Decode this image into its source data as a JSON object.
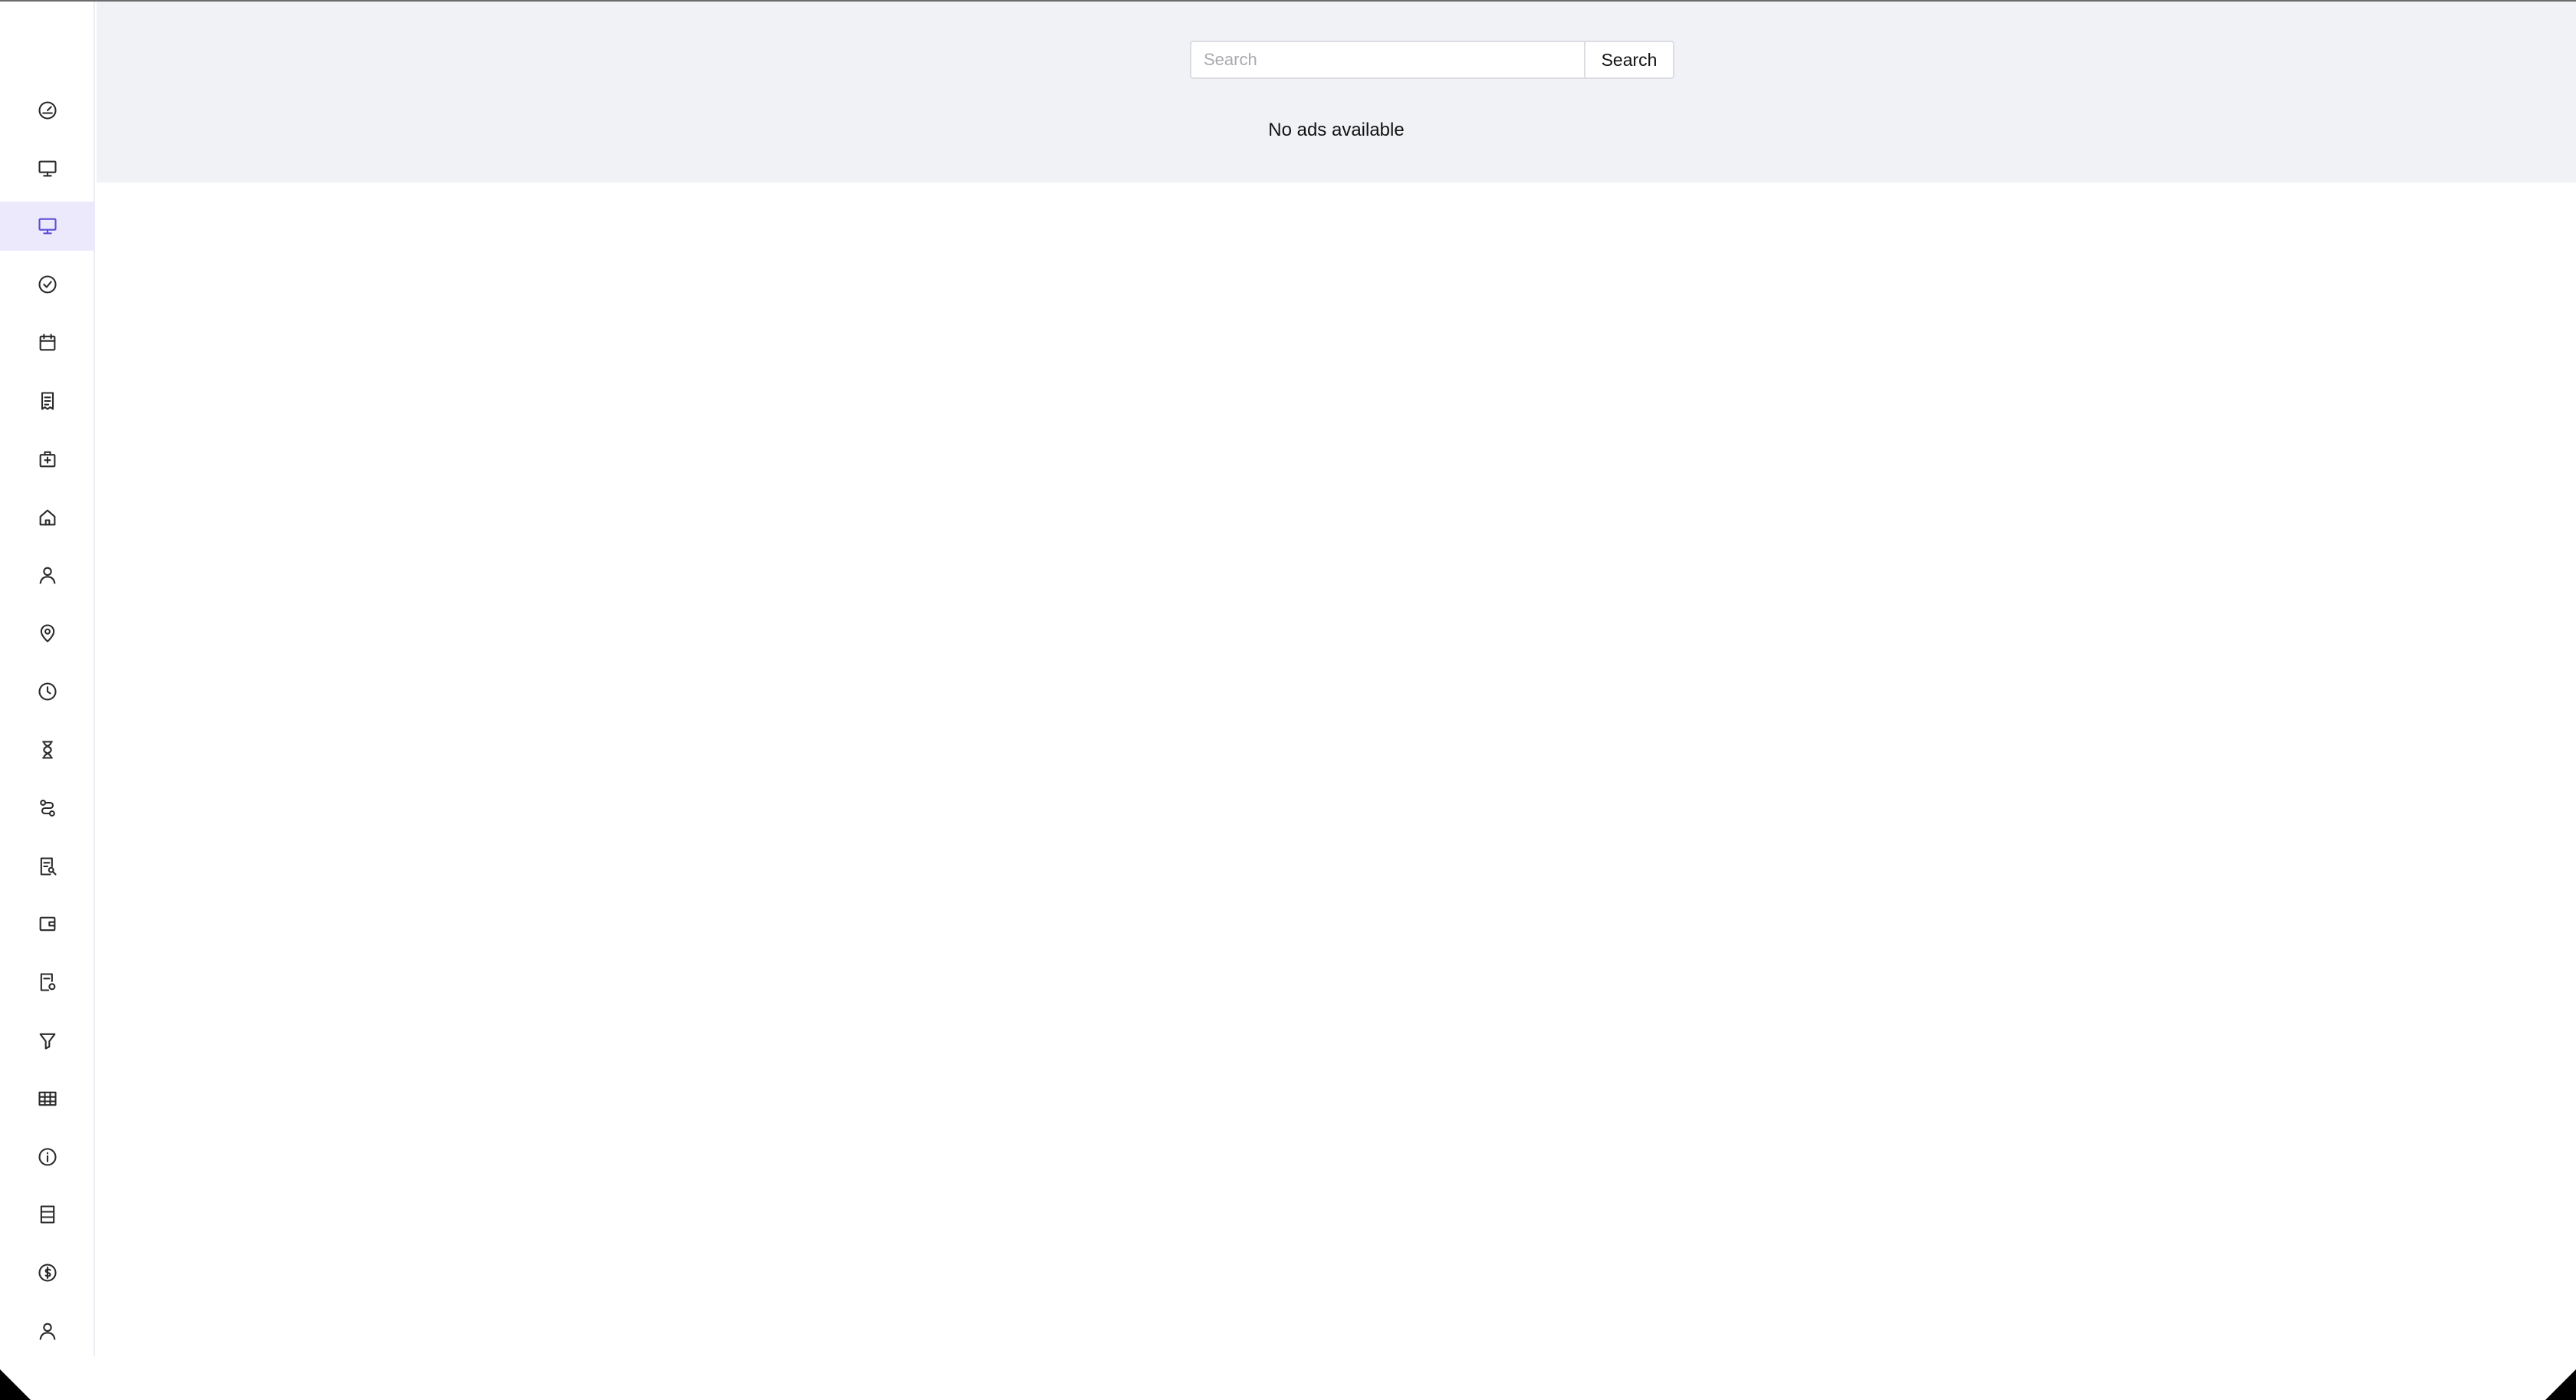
{
  "search": {
    "placeholder": "Search",
    "value": "",
    "button_label": "Search"
  },
  "main": {
    "empty_message": "No ads available"
  },
  "sidebar": {
    "active_index": 2,
    "items": [
      {
        "icon": "gauge-icon"
      },
      {
        "icon": "monitor-icon"
      },
      {
        "icon": "monitor-icon"
      },
      {
        "icon": "check-circle-icon"
      },
      {
        "icon": "calendar-icon"
      },
      {
        "icon": "receipt-icon"
      },
      {
        "icon": "medical-bag-icon"
      },
      {
        "icon": "home-icon"
      },
      {
        "icon": "user-icon"
      },
      {
        "icon": "map-pin-icon"
      },
      {
        "icon": "clock-icon"
      },
      {
        "icon": "hourglass-icon"
      },
      {
        "icon": "route-icon"
      },
      {
        "icon": "document-search-icon"
      },
      {
        "icon": "wallet-icon"
      },
      {
        "icon": "document-settings-icon"
      },
      {
        "icon": "filter-icon"
      },
      {
        "icon": "table-icon"
      },
      {
        "icon": "info-icon"
      },
      {
        "icon": "list-icon"
      },
      {
        "icon": "dollar-circle-icon"
      },
      {
        "icon": "user-icon"
      }
    ]
  },
  "colors": {
    "accent": "#5b4fd6",
    "active_bg": "#ebe9fb",
    "band_bg": "#f1f2f6"
  }
}
